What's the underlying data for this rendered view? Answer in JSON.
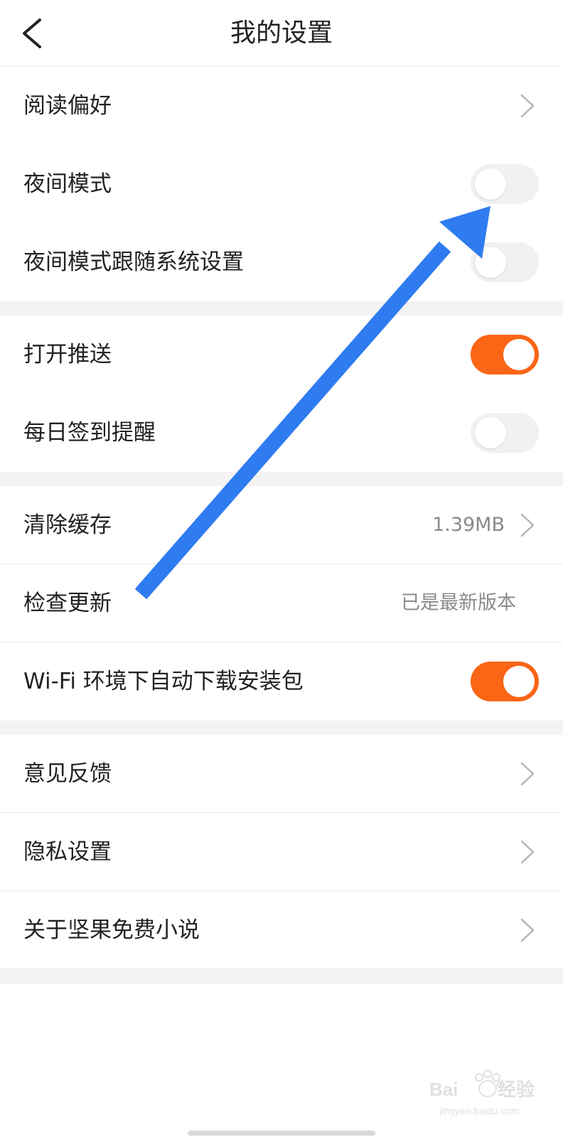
{
  "header": {
    "title": "我的设置"
  },
  "groups": [
    {
      "rows": [
        {
          "label": "阅读偏好",
          "control": "chevron"
        },
        {
          "label": "夜间模式",
          "control": "toggle",
          "on": false
        },
        {
          "label": "夜间模式跟随系统设置",
          "control": "toggle",
          "on": false
        }
      ]
    },
    {
      "rows": [
        {
          "label": "打开推送",
          "control": "toggle",
          "on": true
        },
        {
          "label": "每日签到提醒",
          "control": "toggle",
          "on": false
        }
      ]
    },
    {
      "rows": [
        {
          "label": "清除缓存",
          "value": "1.39MB",
          "control": "chevron"
        },
        {
          "label": "检查更新",
          "value": "已是最新版本",
          "control": "none"
        },
        {
          "label": "Wi-Fi 环境下自动下载安装包",
          "control": "toggle",
          "on": true
        }
      ]
    },
    {
      "rows": [
        {
          "label": "意见反馈",
          "control": "chevron"
        },
        {
          "label": "隐私设置",
          "control": "chevron"
        },
        {
          "label": "关于坚果免费小说",
          "control": "chevron"
        }
      ]
    }
  ],
  "colors": {
    "accent": "#fb6516",
    "toggle_off": "#f1f1f1",
    "annotation_arrow": "#2f7bf0",
    "section_gap": "#f3f3f3"
  },
  "icons": {
    "back": "back-arrow-icon",
    "chevron": "chevron-right-icon"
  },
  "watermark": {
    "brand": "Baidu经验",
    "url": "jingyan.baidu.com"
  }
}
